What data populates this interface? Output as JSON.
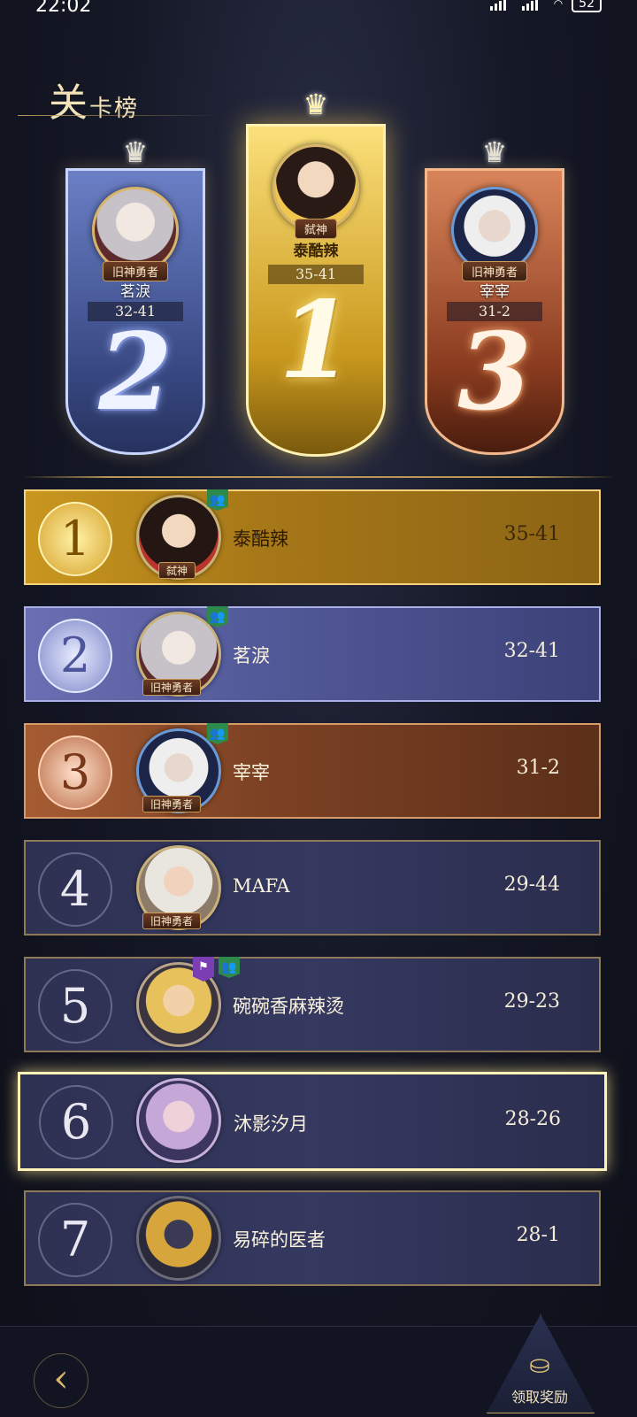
{
  "status_bar": {
    "time": "22:02",
    "battery": "52"
  },
  "page": {
    "title_main": "关",
    "title_rest": "卡榜"
  },
  "podium": [
    {
      "rank": "2",
      "name": "茗淚",
      "score": "32-41",
      "badge": "旧神勇者"
    },
    {
      "rank": "1",
      "name": "泰酷辣",
      "score": "35-41",
      "badge": "弑神"
    },
    {
      "rank": "3",
      "name": "宰宰",
      "score": "31-2",
      "badge": "旧神勇者"
    }
  ],
  "rows": [
    {
      "rank": "1",
      "name": "泰酷辣",
      "score": "35-41",
      "badge": "弑神"
    },
    {
      "rank": "2",
      "name": "茗淚",
      "score": "32-41",
      "badge": "旧神勇者"
    },
    {
      "rank": "3",
      "name": "宰宰",
      "score": "31-2",
      "badge": "旧神勇者"
    },
    {
      "rank": "4",
      "name": "MAFA",
      "score": "29-44",
      "badge": "旧神勇者"
    },
    {
      "rank": "5",
      "name": "碗碗香麻辣烫",
      "score": "29-23"
    },
    {
      "rank": "6",
      "name": "沐影汐月",
      "score": "28-26"
    },
    {
      "rank": "7",
      "name": "易碎的医者",
      "score": "28-1"
    }
  ],
  "bottom": {
    "reward_label": "领取奖励"
  },
  "colors": {
    "gold": "#d7b56b",
    "row_dark": "#353960",
    "group_icon": "#2e8a4a",
    "guild_icon": "#7b3fb3"
  },
  "icons": {
    "group": "group-icon",
    "guild": "guild-banner-icon",
    "back": "back-arrow-icon",
    "reward": "treasure-chest-icon"
  }
}
